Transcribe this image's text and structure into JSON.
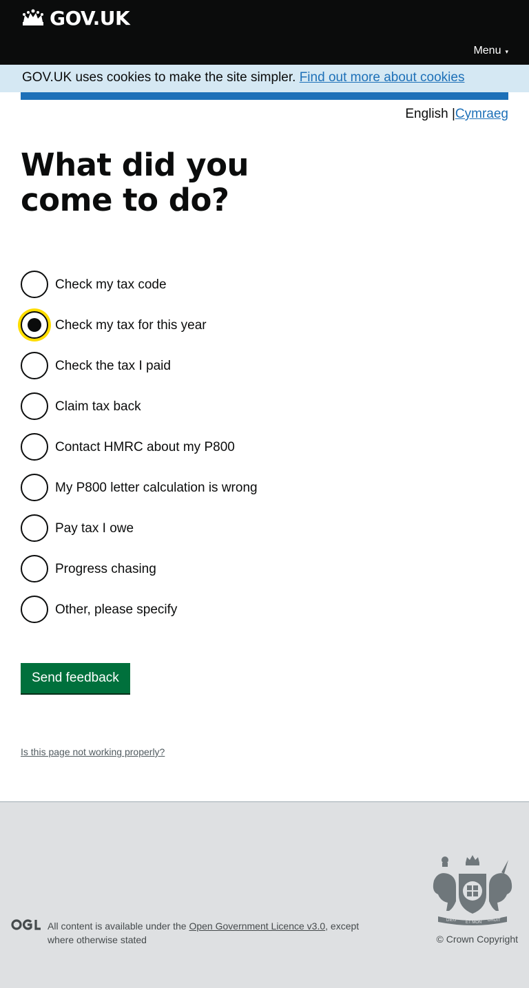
{
  "header": {
    "logo_text": "GOV.UK",
    "menu_label": "Menu",
    "menu_caret": "▾"
  },
  "cookie_banner": {
    "text": "GOV.UK uses cookies to make the site simpler.",
    "link": "Find out more about cookies"
  },
  "language": {
    "current": "English",
    "separator": "|",
    "other": "Cymraeg"
  },
  "page_title": "What did you come to do?",
  "options": [
    {
      "label": "Check my tax code",
      "checked": false
    },
    {
      "label": "Check my tax for this year",
      "checked": true
    },
    {
      "label": "Check the tax I paid",
      "checked": false
    },
    {
      "label": "Claim tax back",
      "checked": false
    },
    {
      "label": "Contact HMRC about my P800",
      "checked": false
    },
    {
      "label": "My P800 letter calculation is wrong",
      "checked": false
    },
    {
      "label": "Pay tax I owe",
      "checked": false
    },
    {
      "label": "Progress chasing",
      "checked": false
    },
    {
      "label": "Other, please specify",
      "checked": false
    }
  ],
  "submit_label": "Send feedback",
  "report_link": "Is this page not working properly?",
  "footer": {
    "licence_prefix": "All content is available under the",
    "licence_link": "Open Government Licence v3.0",
    "licence_suffix": ", except where otherwise stated",
    "copyright": "© Crown Copyright",
    "crest_motto_left": "DIEU",
    "crest_motto_mid": "ET MON",
    "crest_motto_right": "DROIT"
  },
  "colors": {
    "header_bg": "#0b0c0c",
    "cookie_bg": "#d5e8f3",
    "brand_blue": "#1d70b8",
    "focus_yellow": "#ffdd00",
    "button_green": "#00703c",
    "footer_bg": "#dee0e2"
  },
  "icons": [
    "crown-icon",
    "menu-caret-icon",
    "ogl-logo-icon",
    "royal-crest-icon"
  ]
}
